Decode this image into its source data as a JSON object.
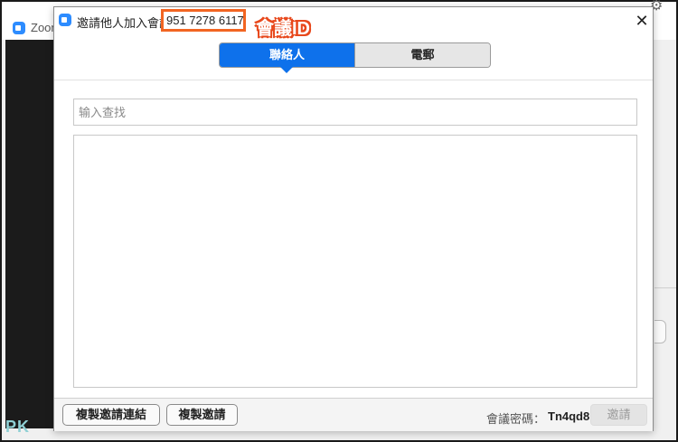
{
  "background_window": {
    "title": "Zoom",
    "watermark": "PK"
  },
  "dialog": {
    "title": "邀請他人加入會議",
    "meeting_id": "951 7278 6117",
    "annotation": "會議ID",
    "close_label": "✕"
  },
  "tabs": [
    {
      "label": "聯絡人",
      "active": true
    },
    {
      "label": "電郵",
      "active": false
    }
  ],
  "search": {
    "placeholder": "输入查找",
    "value": ""
  },
  "footer": {
    "copy_link_label": "複製邀請連結",
    "copy_invite_label": "複製邀請",
    "password_label": "會議密碼：",
    "password_value": "Tn4qd8",
    "invite_label": "邀請"
  },
  "colors": {
    "accent": "#0e71eb",
    "annotation": "#e8491d",
    "highlight_box": "#f26522"
  }
}
